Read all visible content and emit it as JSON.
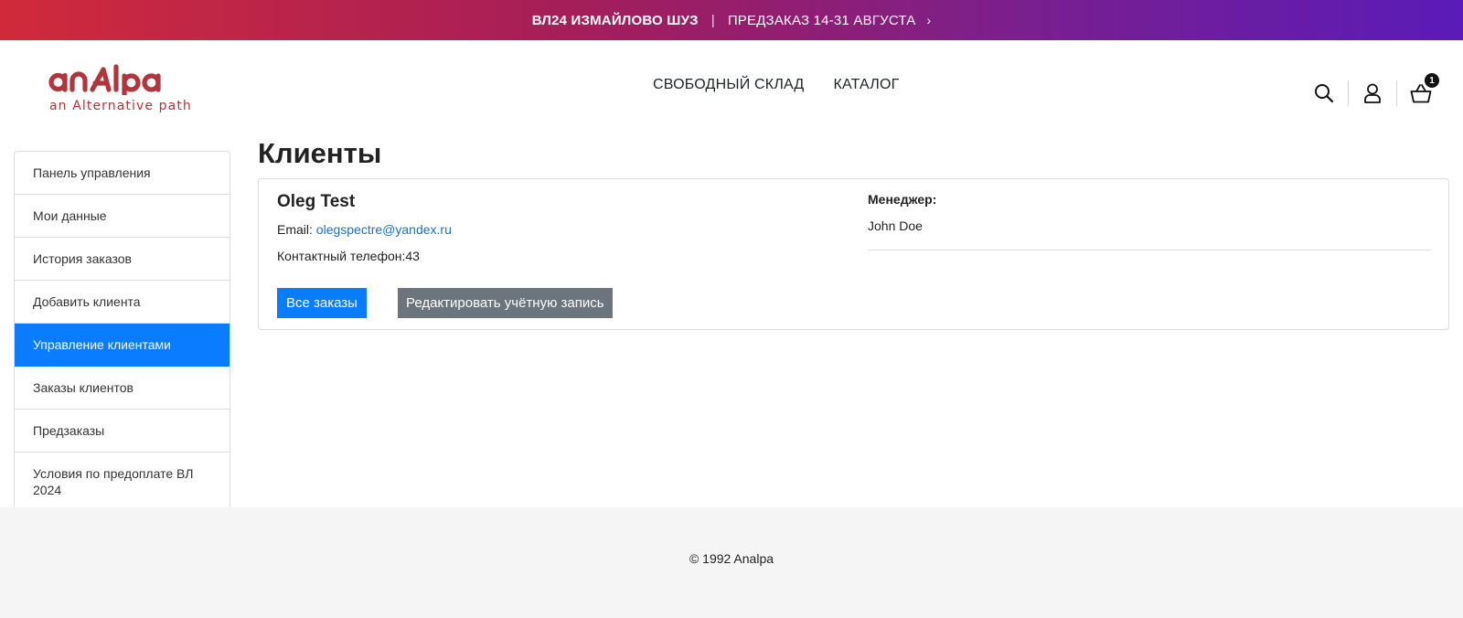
{
  "promo": {
    "strong": "ВЛ24 ИЗМАЙЛОВО ШУЗ",
    "separator": "|",
    "text": "ПРЕДЗАКАЗ 14-31 АВГУСТА",
    "chevron": "›"
  },
  "logo": {
    "wordmark": "analpa",
    "tagline": "an Alternative path",
    "color": "#b3343a"
  },
  "nav": {
    "items": [
      {
        "label": "СВОБОДНЫЙ СКЛАД"
      },
      {
        "label": "КАТАЛОГ"
      }
    ]
  },
  "header_icons": {
    "search": "search-icon",
    "account": "user-icon",
    "cart": "basket-icon",
    "cart_count": "1"
  },
  "sidebar": {
    "items": [
      {
        "label": "Панель управления"
      },
      {
        "label": "Мои данные"
      },
      {
        "label": "История заказов"
      },
      {
        "label": "Добавить клиента"
      },
      {
        "label": "Управление клиентами",
        "active": true
      },
      {
        "label": "Заказы клиентов"
      },
      {
        "label": "Предзаказы"
      },
      {
        "label": "Условия по предоплате ВЛ 2024"
      }
    ]
  },
  "page": {
    "title": "Клиенты"
  },
  "client": {
    "name": "Oleg Test",
    "email_label": "Email:",
    "email": "olegspectre@yandex.ru",
    "phone_label": "Контактный телефон:",
    "phone": "43",
    "manager_label": "Менеджер:",
    "manager_name": "John Doe",
    "btn_orders": "Все заказы",
    "btn_edit": "Редактировать учётную запись"
  },
  "footer": {
    "copyright": "© 1992 Analpa"
  },
  "colors": {
    "accent": "#0a7cff",
    "secondary_button": "#6c757d",
    "link": "#1a73c8",
    "brand": "#b3343a"
  }
}
